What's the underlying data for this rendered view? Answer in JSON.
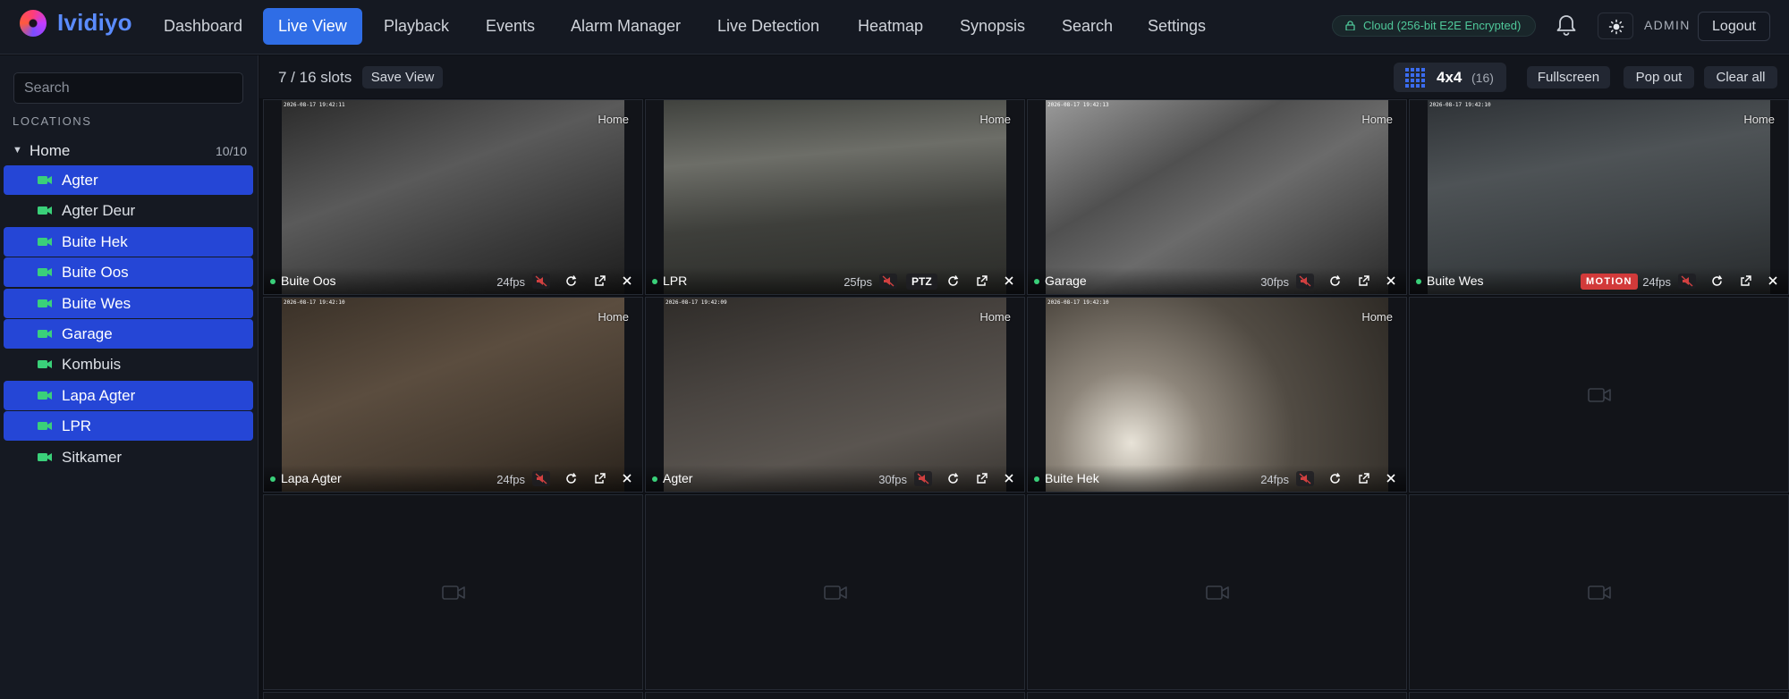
{
  "app": {
    "name": "Ividiyo"
  },
  "nav": [
    {
      "label": "Dashboard"
    },
    {
      "label": "Live View",
      "active": true
    },
    {
      "label": "Playback"
    },
    {
      "label": "Events"
    },
    {
      "label": "Alarm Manager"
    },
    {
      "label": "Live Detection"
    },
    {
      "label": "Heatmap"
    },
    {
      "label": "Synopsis"
    },
    {
      "label": "Search"
    },
    {
      "label": "Settings"
    }
  ],
  "header": {
    "cloud_status": "Cloud (256-bit E2E Encrypted)",
    "user": "ADMIN",
    "logout_label": "Logout"
  },
  "sidebar": {
    "search_placeholder": "Search",
    "section_title": "LOCATIONS",
    "location": {
      "name": "Home",
      "count": "10/10"
    },
    "cameras": [
      {
        "label": "Agter",
        "selected": true
      },
      {
        "label": "Agter Deur",
        "selected": false
      },
      {
        "label": "Buite Hek",
        "selected": true
      },
      {
        "label": "Buite Oos",
        "selected": true
      },
      {
        "label": "Buite Wes",
        "selected": true
      },
      {
        "label": "Garage",
        "selected": true
      },
      {
        "label": "Kombuis",
        "selected": false
      },
      {
        "label": "Lapa Agter",
        "selected": true
      },
      {
        "label": "LPR",
        "selected": true
      },
      {
        "label": "Sitkamer",
        "selected": false
      }
    ]
  },
  "toolbar": {
    "slots": "7 / 16 slots",
    "save_view_label": "Save View",
    "grid_label": "4x4",
    "grid_count": "(16)",
    "fullscreen_label": "Fullscreen",
    "popout_label": "Pop out",
    "clear_label": "Clear all"
  },
  "tiles": [
    {
      "name": "Buite Oos",
      "fps": "24fps",
      "location": "Home",
      "timestamp": "2026-08-17 19:42:11",
      "ptz": false,
      "motion": false
    },
    {
      "name": "LPR",
      "fps": "25fps",
      "location": "Home",
      "timestamp": "",
      "ptz": true,
      "ptz_label": "PTZ",
      "motion": false
    },
    {
      "name": "Garage",
      "fps": "30fps",
      "location": "Home",
      "timestamp": "2026-08-17 19:42:13",
      "ptz": false,
      "motion": false
    },
    {
      "name": "Buite Wes",
      "fps": "24fps",
      "location": "Home",
      "timestamp": "2026-08-17 19:42:10",
      "ptz": false,
      "motion": true,
      "motion_label": "MOTION"
    },
    {
      "name": "Lapa Agter",
      "fps": "24fps",
      "location": "Home",
      "timestamp": "2026-08-17 19:42:10",
      "ptz": false,
      "motion": false
    },
    {
      "name": "Agter",
      "fps": "30fps",
      "location": "Home",
      "timestamp": "2026-08-17 19:42:09",
      "ptz": false,
      "motion": false
    },
    {
      "name": "Buite Hek",
      "fps": "24fps",
      "location": "Home",
      "timestamp": "2026-08-17 19:42:10",
      "ptz": false,
      "motion": false
    }
  ],
  "icons": {
    "brand_logo": "logo-icon",
    "lock": "lock-icon",
    "bell": "bell-icon",
    "theme": "sun-icon",
    "grid": "grid-icon",
    "camera": "video-camera-icon",
    "mute": "mute-icon",
    "reload": "reload-icon",
    "popout": "external-link-icon",
    "close": "close-icon"
  },
  "colors": {
    "accent": "#2f6de6",
    "selected": "#2546d6",
    "live_dot": "#3ad07a",
    "motion": "#d23a3a",
    "cloud": "#4fc89a"
  }
}
